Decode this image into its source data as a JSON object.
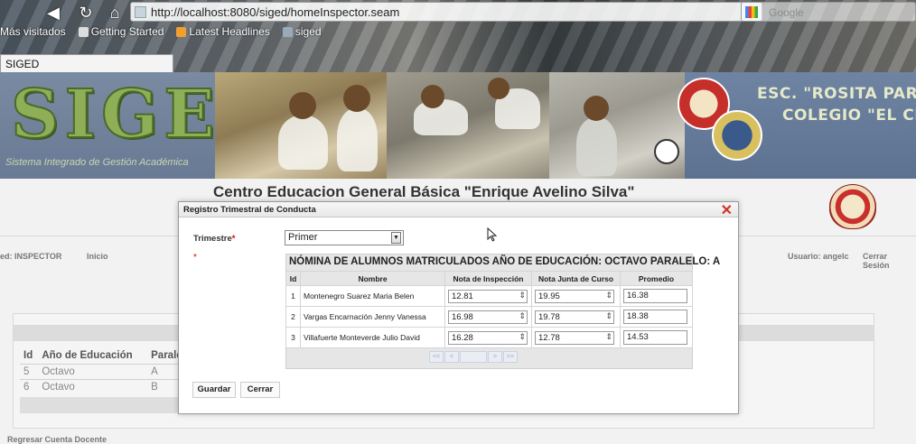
{
  "browser": {
    "url": "http://localhost:8080/siged/homeInspector.seam",
    "search_placeholder": "Google",
    "bookmarks": [
      "Más visitados",
      "Getting Started",
      "Latest Headlines",
      "siged"
    ],
    "tab_title": "SIGED"
  },
  "banner": {
    "logo": "SIGED",
    "tagline": "Sistema Integrado de Gestión Académica",
    "school_line1": "ESC. \"ROSITA PAREDES",
    "school_line2": "COLEGIO \"EL CHACO"
  },
  "page": {
    "center_name": "Centro Educacion General Básica \"Enrique Avelino Silva\"",
    "role": "ed: INSPECTOR",
    "home": "Inicio",
    "user": "Usuario: angelc",
    "logout": "Cerrar Sesión",
    "back": "Regresar Cuenta Docente"
  },
  "bg_table": {
    "headers": [
      "Id",
      "Año de Educación",
      "Paralelo"
    ],
    "rows": [
      {
        "id": "5",
        "year": "Octavo",
        "paralelo": "A"
      },
      {
        "id": "6",
        "year": "Octavo",
        "paralelo": "B"
      }
    ]
  },
  "modal": {
    "title": "Registro Trimestral de Conducta",
    "close": "✕",
    "trimestre_label": "Trimestre",
    "required_mark": "*",
    "trimestre_value": "Primer",
    "select_arrow": "▼",
    "nomina_title": "NÓMINA DE ALUMNOS MATRICULADOS AÑO DE EDUCACIÓN: OCTAVO PARALELO: A",
    "columns": [
      "Id",
      "Nombre",
      "Nota de Inspección",
      "Nota Junta de Curso",
      "Promedio"
    ],
    "students": [
      {
        "id": "1",
        "name": "Montenegro Suarez Maria Belen",
        "inspeccion": "12.81",
        "junta": "19.95",
        "promedio": "16.38"
      },
      {
        "id": "2",
        "name": "Vargas Encarnación Jenny Vanessa",
        "inspeccion": "16.98",
        "junta": "19.78",
        "promedio": "18.38"
      },
      {
        "id": "3",
        "name": "Villafuerte Monteverde Julio David",
        "inspeccion": "16.28",
        "junta": "12.78",
        "promedio": "14.53"
      }
    ],
    "spinner_symbol": "⇕",
    "pager": [
      "<<",
      "<",
      "",
      ">",
      ">>"
    ],
    "save": "Guardar",
    "close_button": "Cerrar"
  },
  "colors": {
    "accent_red": "#d0332a",
    "banner_blue": "#6e7f97",
    "logo_green": "#8fae58"
  },
  "icons": [
    "back-arrow-icon",
    "reload-icon",
    "home-icon",
    "favicon-icon",
    "close-icon",
    "dropdown-arrow-icon",
    "mouse-cursor-icon",
    "spinner-icon",
    "school-crest-icon"
  ]
}
